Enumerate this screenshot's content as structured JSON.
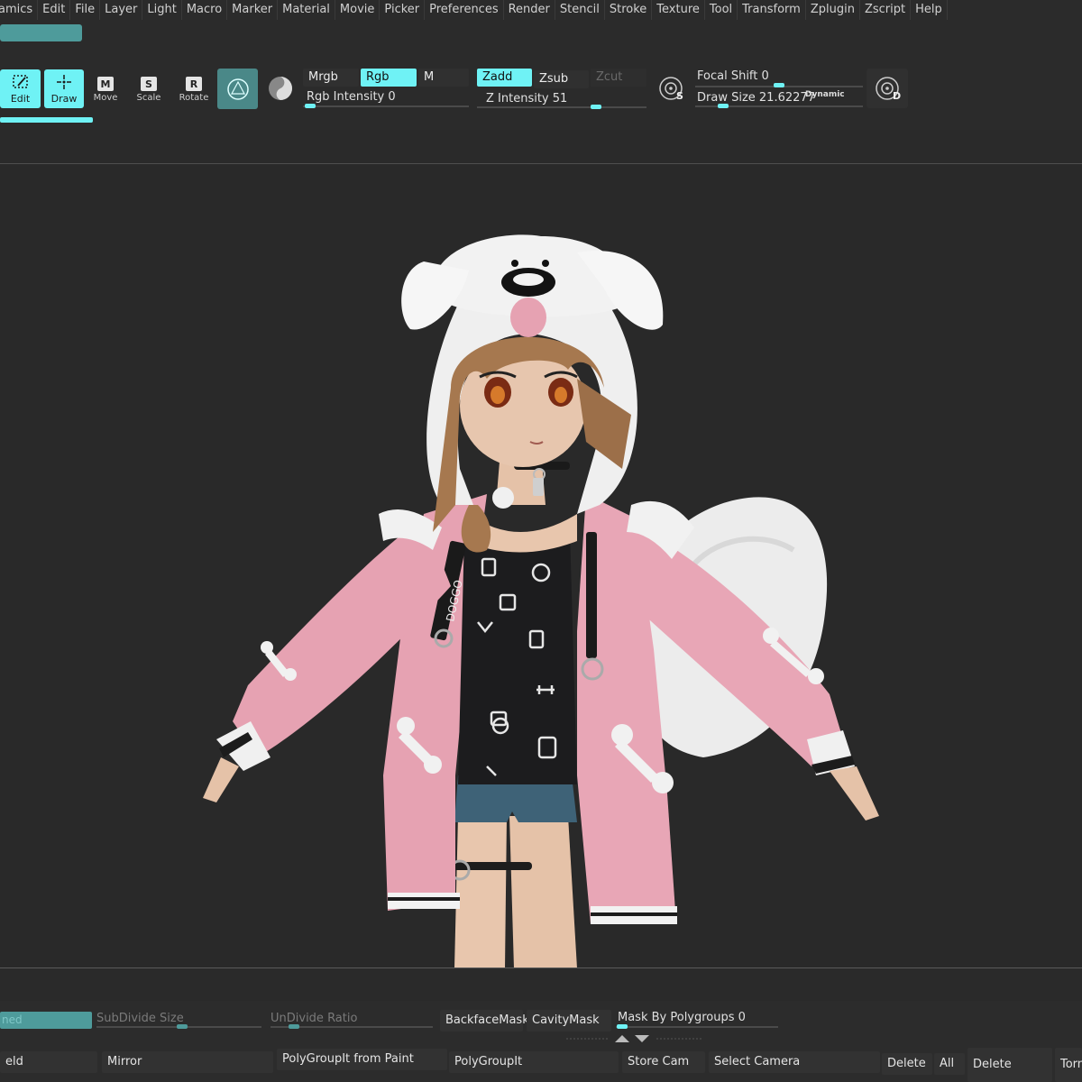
{
  "menu": [
    "amics",
    "Edit",
    "File",
    "Layer",
    "Light",
    "Macro",
    "Marker",
    "Material",
    "Movie",
    "Picker",
    "Preferences",
    "Render",
    "Stencil",
    "Stroke",
    "Texture",
    "Tool",
    "Transform",
    "Zplugin",
    "Zscript",
    "Help"
  ],
  "tools": {
    "edit": "Edit",
    "draw": "Draw",
    "move": "Move",
    "scale": "Scale",
    "rotate": "Rotate",
    "move_key": "M",
    "scale_key": "S",
    "rotate_key": "R"
  },
  "color_mode": {
    "mrgb": "Mrgb",
    "rgb": "Rgb",
    "m": "M",
    "rgb_intensity": "Rgb Intensity 0"
  },
  "z_mode": {
    "zadd": "Zadd",
    "zsub": "Zsub",
    "zcut": "Zcut",
    "z_intensity": "Z Intensity 51"
  },
  "brush": {
    "focal_shift": "Focal Shift 0",
    "draw_size": "Draw Size 21.62277",
    "dynamic": "Dynamic",
    "lazy_s": "S",
    "lazy_d": "D"
  },
  "model_text": {
    "hood_label": "DOGGO"
  },
  "bottom": {
    "ned_field": "ned",
    "subdivide_size": "SubDivide Size",
    "undivide_ratio": "UnDivide Ratio",
    "backface_mask": "BackfaceMask",
    "cavity_mask": "CavityMask",
    "mask_by_polygroups": "Mask By Polygroups 0",
    "eld": "eld",
    "mirror": "Mirror",
    "polygroupit_from_paint": "PolyGroupIt from Paint",
    "polygroupit": "PolyGroupIt",
    "store_cam": "Store Cam",
    "select_camera": "Select Camera",
    "delete": "Delete",
    "all": "All",
    "delete2": "Delete",
    "torn": "Torn"
  },
  "colors": {
    "accent": "#6ff2f5",
    "teal": "#4e9b9b",
    "background": "#2a2a2a",
    "hoodie_pink": "#e8a3b3",
    "hood_white": "#f0f0f0",
    "shirt_black": "#1c1c1e",
    "hair_brown": "#a6784f"
  }
}
